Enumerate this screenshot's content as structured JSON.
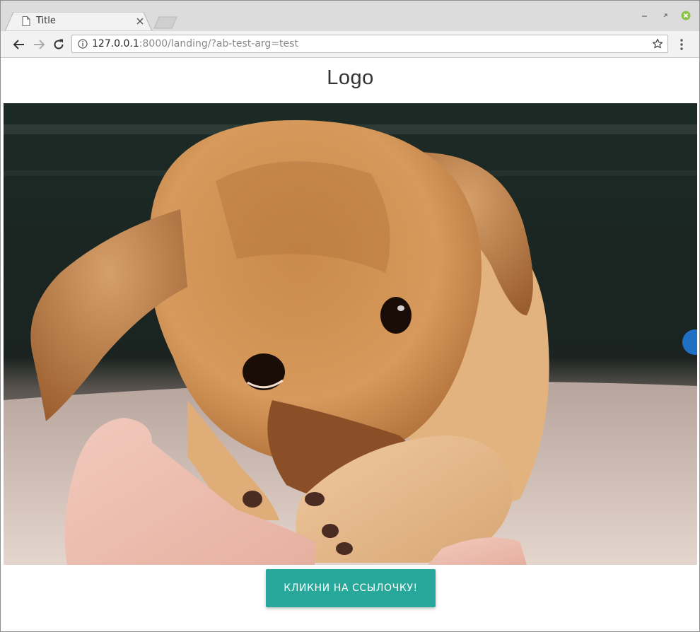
{
  "browser": {
    "tab_title": "Title",
    "url_host": "127.0.0.1",
    "url_rest": ":8000/landing/?ab-test-arg=test"
  },
  "page": {
    "logo_text": "Logo",
    "hero_image_alt": "puppy-photo",
    "cta_label": "КЛИКНИ НА ССЫЛОЧКУ!"
  },
  "colors": {
    "accent": "#27a89a",
    "tabstrip_bg": "#dcdcdc",
    "toolbar_bg": "#f2f2f2",
    "close_green": "#8bc34a"
  }
}
